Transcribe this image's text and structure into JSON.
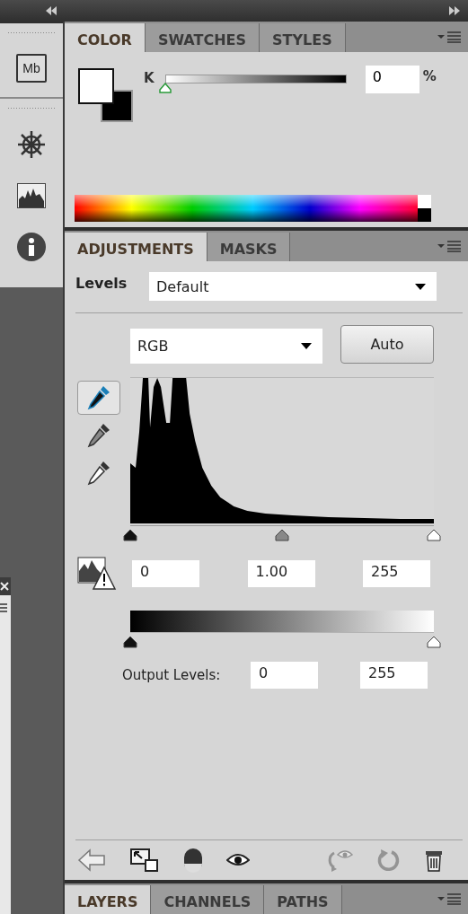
{
  "dock": {
    "items": [
      {
        "kind": "mini-bridge",
        "label": "Mb"
      },
      {
        "kind": "navigator"
      },
      {
        "kind": "histogram"
      },
      {
        "kind": "info"
      }
    ]
  },
  "color_panel": {
    "tabs": [
      {
        "label": "COLOR",
        "selected": true
      },
      {
        "label": "SWATCHES",
        "selected": false
      },
      {
        "label": "STYLES",
        "selected": false
      }
    ],
    "channel_label": "K",
    "slider": {
      "level": 0
    },
    "value": "0",
    "unit": "%"
  },
  "adjustments_panel": {
    "tabs": [
      {
        "label": "ADJUSTMENTS",
        "selected": true
      },
      {
        "label": "MASKS",
        "selected": false
      }
    ],
    "title": "Levels",
    "preset": "Default",
    "channel": "RGB",
    "auto_button": "Auto",
    "eyedroppers": [
      {
        "kind": "black",
        "selected": true
      },
      {
        "kind": "gray",
        "selected": false
      },
      {
        "kind": "white",
        "selected": false
      }
    ],
    "input_sliders": [
      {
        "kind": "black",
        "level": 0
      },
      {
        "kind": "gray",
        "level": 0.5
      },
      {
        "kind": "white",
        "level": 1
      }
    ],
    "input_values": [
      "0",
      "1.00",
      "255"
    ],
    "output_sliders": [
      {
        "kind": "black",
        "level": 0
      },
      {
        "kind": "white",
        "level": 1
      }
    ],
    "output_label": "Output Levels:",
    "output_values": [
      "0",
      "255"
    ],
    "toolbar": [
      {
        "kind": "back",
        "disabled": false
      },
      {
        "kind": "clip",
        "disabled": false
      },
      {
        "kind": "visibility",
        "disabled": false
      },
      {
        "kind": "eye",
        "disabled": false
      },
      {
        "kind": "previous",
        "disabled": true
      },
      {
        "kind": "reset",
        "disabled": true
      },
      {
        "kind": "trash",
        "disabled": false
      }
    ]
  },
  "bottom_panel": {
    "tabs": [
      {
        "label": "LAYERS",
        "selected": true
      },
      {
        "label": "CHANNELS",
        "selected": false
      },
      {
        "label": "PATHS",
        "selected": false
      }
    ]
  }
}
